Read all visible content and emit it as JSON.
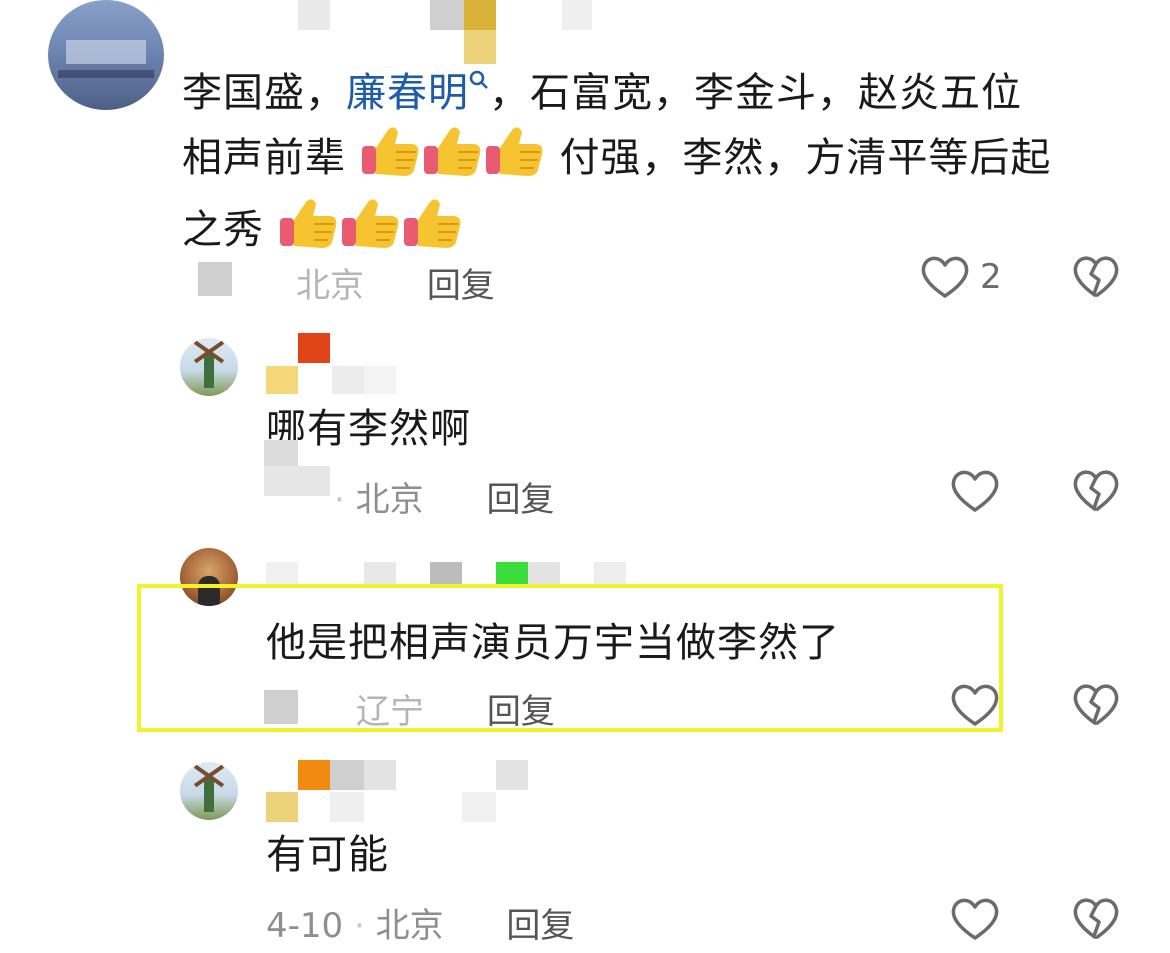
{
  "comments": [
    {
      "text_before_mention": "李国盛，",
      "mention": "廉春明",
      "mention_icon": "search-icon",
      "text_after_mention": "，石富宽，李金斗，赵炎五位",
      "line2_a": "相声前辈",
      "line2_b": "付强，李然，方清平等后起",
      "line3": "之秀",
      "emoji": "thumbs-up-icon",
      "location": "北京",
      "reply": "回复",
      "likes": "2"
    },
    {
      "text": "哪有李然啊",
      "location": "北京",
      "reply": "回复"
    },
    {
      "text": "他是把相声演员万宇当做李然了",
      "location": "辽宁",
      "reply": "回复"
    },
    {
      "text": "有可能",
      "date": "4-10",
      "location": "北京",
      "reply": "回复"
    }
  ],
  "colors": {
    "highlight": "#f1f22a",
    "mention": "#1e5ba8"
  }
}
